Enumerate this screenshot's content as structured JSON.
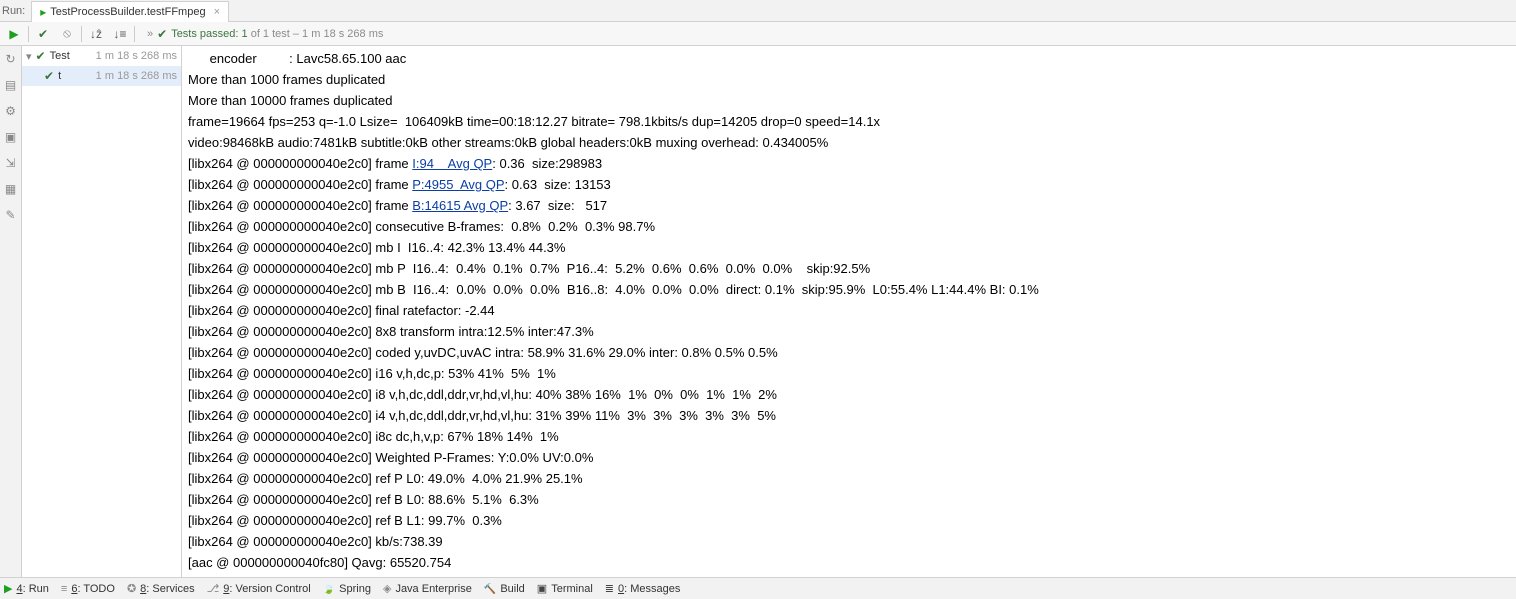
{
  "top": {
    "run_label": "Run:",
    "tab_title": "TestProcessBuilder.testFFmpeg"
  },
  "toolbar": {
    "status_prefix": "»",
    "status_phrase_a": "Tests passed: ",
    "status_count": "1",
    "status_suffix": " of 1 test – 1 m 18 s 268 ms"
  },
  "tree": {
    "root_label": "Test",
    "root_time": "1 m 18 s 268 ms",
    "child_label": "t",
    "child_time": "1 m 18 s 268 ms"
  },
  "console_lines": [
    {
      "text": "      encoder         : Lavc58.65.100 aac"
    },
    {
      "text": "More than 1000 frames duplicated"
    },
    {
      "text": "More than 10000 frames duplicated"
    },
    {
      "text": "frame=19664 fps=253 q=-1.0 Lsize=  106409kB time=00:18:12.27 bitrate= 798.1kbits/s dup=14205 drop=0 speed=14.1x"
    },
    {
      "text": "video:98468kB audio:7481kB subtitle:0kB other streams:0kB global headers:0kB muxing overhead: 0.434005%"
    },
    {
      "pre": "[libx264 @ 000000000040e2c0] frame ",
      "link": "I:94    Avg QP",
      "post": ": 0.36  size:298983"
    },
    {
      "pre": "[libx264 @ 000000000040e2c0] frame ",
      "link": "P:4955  Avg QP",
      "post": ": 0.63  size: 13153"
    },
    {
      "pre": "[libx264 @ 000000000040e2c0] frame ",
      "link": "B:14615 Avg QP",
      "post": ": 3.67  size:   517"
    },
    {
      "text": "[libx264 @ 000000000040e2c0] consecutive B-frames:  0.8%  0.2%  0.3% 98.7%"
    },
    {
      "text": "[libx264 @ 000000000040e2c0] mb I  I16..4: 42.3% 13.4% 44.3%"
    },
    {
      "text": "[libx264 @ 000000000040e2c0] mb P  I16..4:  0.4%  0.1%  0.7%  P16..4:  5.2%  0.6%  0.6%  0.0%  0.0%    skip:92.5%"
    },
    {
      "text": "[libx264 @ 000000000040e2c0] mb B  I16..4:  0.0%  0.0%  0.0%  B16..8:  4.0%  0.0%  0.0%  direct: 0.1%  skip:95.9%  L0:55.4% L1:44.4% BI: 0.1%"
    },
    {
      "text": "[libx264 @ 000000000040e2c0] final ratefactor: -2.44"
    },
    {
      "text": "[libx264 @ 000000000040e2c0] 8x8 transform intra:12.5% inter:47.3%"
    },
    {
      "text": "[libx264 @ 000000000040e2c0] coded y,uvDC,uvAC intra: 58.9% 31.6% 29.0% inter: 0.8% 0.5% 0.5%"
    },
    {
      "text": "[libx264 @ 000000000040e2c0] i16 v,h,dc,p: 53% 41%  5%  1%"
    },
    {
      "text": "[libx264 @ 000000000040e2c0] i8 v,h,dc,ddl,ddr,vr,hd,vl,hu: 40% 38% 16%  1%  0%  0%  1%  1%  2%"
    },
    {
      "text": "[libx264 @ 000000000040e2c0] i4 v,h,dc,ddl,ddr,vr,hd,vl,hu: 31% 39% 11%  3%  3%  3%  3%  3%  5%"
    },
    {
      "text": "[libx264 @ 000000000040e2c0] i8c dc,h,v,p: 67% 18% 14%  1%"
    },
    {
      "text": "[libx264 @ 000000000040e2c0] Weighted P-Frames: Y:0.0% UV:0.0%"
    },
    {
      "text": "[libx264 @ 000000000040e2c0] ref P L0: 49.0%  4.0% 21.9% 25.1%"
    },
    {
      "text": "[libx264 @ 000000000040e2c0] ref B L0: 88.6%  5.1%  6.3%"
    },
    {
      "text": "[libx264 @ 000000000040e2c0] ref B L1: 99.7%  0.3%"
    },
    {
      "text": "[libx264 @ 000000000040e2c0] kb/s:738.39"
    },
    {
      "text": "[aac @ 000000000040fc80] Qavg: 65520.754"
    }
  ],
  "bottom": {
    "run": "4: Run",
    "todo": "6: TODO",
    "services": "8: Services",
    "vc": "9: Version Control",
    "spring": "Spring",
    "java_ee": "Java Enterprise",
    "build": "Build",
    "terminal": "Terminal",
    "messages": "0: Messages"
  }
}
